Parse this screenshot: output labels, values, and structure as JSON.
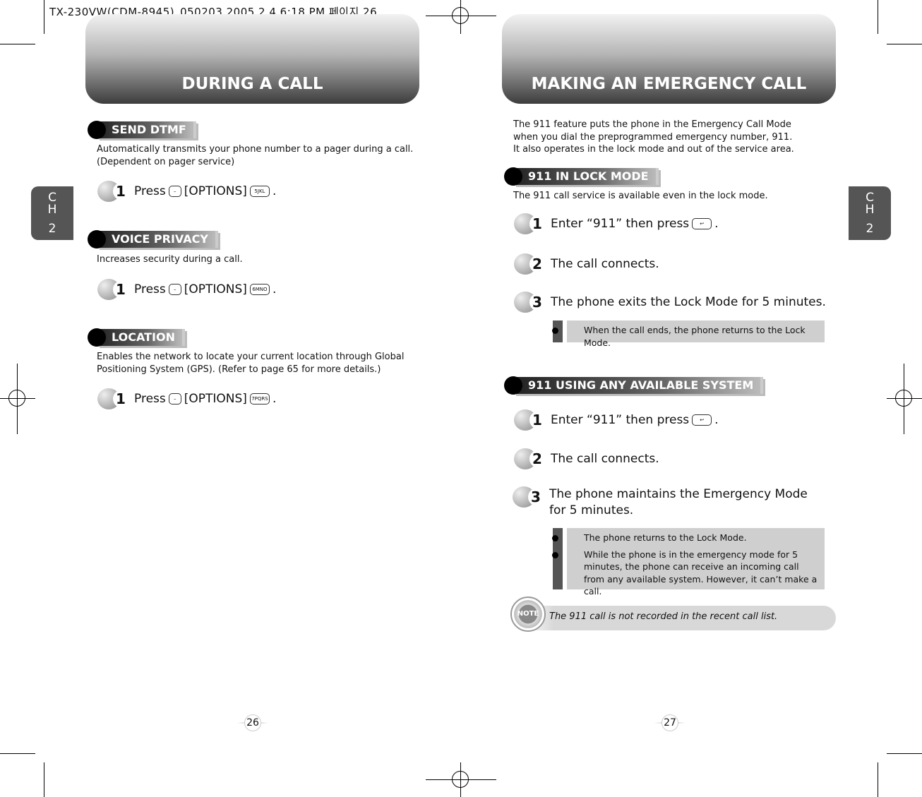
{
  "slug": "TX-230VW(CDM-8945)_050203 2005.2.4 6:18 PM 페이지 26",
  "left": {
    "title": "DURING A CALL",
    "chapter": [
      "C",
      "H",
      "2"
    ],
    "page": "26",
    "sections": [
      {
        "label": "SEND DTMF",
        "desc": [
          "Automatically transmits your phone number to a pager during a call.",
          "(Dependent on pager service)"
        ],
        "step": {
          "num": "1",
          "press": "Press",
          "options": "[OPTIONS]",
          "key": "5JKL",
          "end": "."
        }
      },
      {
        "label": "VOICE PRIVACY",
        "desc": [
          "Increases security during a call."
        ],
        "step": {
          "num": "1",
          "press": "Press",
          "options": "[OPTIONS]",
          "key": "6MNO",
          "end": "."
        }
      },
      {
        "label": "LOCATION",
        "desc": [
          "Enables the network to locate your current location through Global",
          "Positioning System (GPS). (Refer to page 65 for more details.)"
        ],
        "step": {
          "num": "1",
          "press": "Press",
          "options": "[OPTIONS]",
          "key": "7PQRS",
          "end": "."
        }
      }
    ]
  },
  "right": {
    "title": "MAKING AN EMERGENCY CALL",
    "chapter": [
      "C",
      "H",
      "2"
    ],
    "page": "27",
    "intro": [
      "The 911 feature puts the phone in the Emergency Call Mode",
      "when you dial the preprogrammed emergency number, 911.",
      "It also operates in the lock mode and out of the service area."
    ],
    "lock": {
      "label": "911 IN LOCK MODE",
      "desc": "The 911 call service is available even in the lock mode.",
      "steps": [
        {
          "num": "1",
          "text": "Enter “911” then press",
          "end": "."
        },
        {
          "num": "2",
          "text": "The call connects."
        },
        {
          "num": "3",
          "text": "The phone exits the Lock Mode for 5 minutes."
        }
      ],
      "notes": [
        "When the call ends, the phone returns to the Lock Mode."
      ]
    },
    "any": {
      "label": "911 USING ANY AVAILABLE SYSTEM",
      "steps": [
        {
          "num": "1",
          "text": "Enter “911” then press",
          "end": "."
        },
        {
          "num": "2",
          "text": "The call connects."
        },
        {
          "num": "3",
          "text": "The phone maintains the Emergency Mode",
          "text2": "for 5 minutes."
        }
      ],
      "notes": [
        "The phone returns to the Lock Mode.",
        "While the phone is in the emergency mode for 5 minutes, the phone can receive an incoming call from any available system. However, it can’t make a call."
      ]
    },
    "note_label": "NOTE",
    "note": "The 911 call is not recorded in the recent call list."
  }
}
